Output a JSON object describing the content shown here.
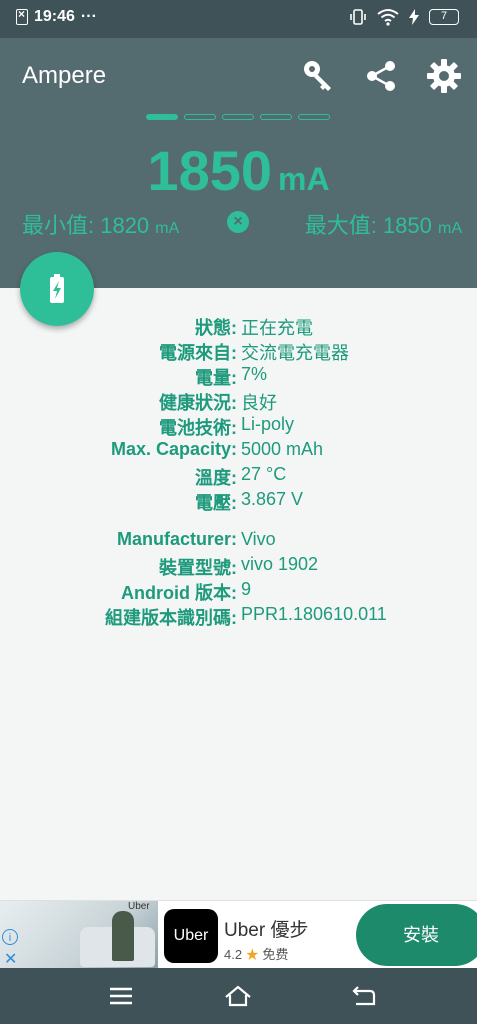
{
  "status_bar": {
    "time": "19:46",
    "dots": "···",
    "battery_level": "7"
  },
  "header": {
    "app_title": "Ampere"
  },
  "reading": {
    "value": "1850",
    "unit": "mA"
  },
  "minmax": {
    "min_label": "最小值: 1820",
    "min_unit": "mA",
    "max_label": "最大值: 1850",
    "max_unit": "mA",
    "clear_symbol": "×"
  },
  "info": {
    "group1": [
      {
        "label": "狀態:",
        "value": "正在充電"
      },
      {
        "label": "電源來自:",
        "value": "交流電充電器"
      },
      {
        "label": "電量:",
        "value": "7%"
      },
      {
        "label": "健康狀況:",
        "value": "良好"
      },
      {
        "label": "電池技術:",
        "value": "Li-poly"
      },
      {
        "label": "Max. Capacity:",
        "value": "5000 mAh"
      },
      {
        "label": "溫度:",
        "value": "27 °C"
      },
      {
        "label": "電壓:",
        "value": "3.867 V"
      }
    ],
    "group2": [
      {
        "label": "Manufacturer:",
        "value": "Vivo"
      },
      {
        "label": "裝置型號:",
        "value": "vivo 1902"
      },
      {
        "label": "Android 版本:",
        "value": "9"
      },
      {
        "label": "組建版本識別碼:",
        "value": "PPR1.180610.011"
      }
    ]
  },
  "ad": {
    "image_tag": "Uber",
    "logo_text": "Uber",
    "title": "Uber 優步",
    "rating": "4.2",
    "star": "★",
    "price": "免费",
    "install_label": "安裝",
    "info_symbol": "i",
    "close_symbol": "✕"
  },
  "colors": {
    "header_bg": "#546b70",
    "status_bg": "#3f5257",
    "accent": "#2fbf98",
    "text_accent": "#1e9a7c",
    "install_bg": "#1e8a6c"
  }
}
